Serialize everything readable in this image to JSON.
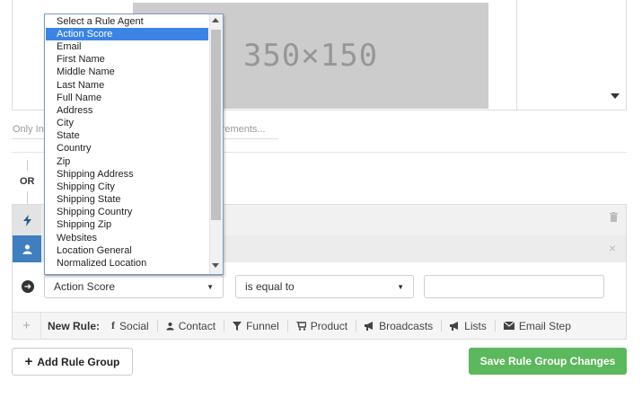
{
  "preview": {
    "placeholder_text": "350×150"
  },
  "helper": {
    "left_text": "Only Inc",
    "right_text": "quirements..."
  },
  "connector": {
    "or_label": "OR"
  },
  "rule_row": {
    "agent_select": {
      "value": "Action Score"
    },
    "operator_select": {
      "value": "is equal to"
    },
    "value_input": {
      "value": ""
    }
  },
  "dropdown": {
    "options": [
      "Select a Rule Agent",
      "Action Score",
      "Email",
      "First Name",
      "Middle Name",
      "Last Name",
      "Full Name",
      "Address",
      "City",
      "State",
      "Country",
      "Zip",
      "Shipping Address",
      "Shipping City",
      "Shipping State",
      "Shipping Country",
      "Shipping Zip",
      "Websites",
      "Location General",
      "Normalized Location"
    ],
    "selected": "Action Score"
  },
  "new_rule": {
    "label": "New Rule:",
    "items": [
      {
        "label": "Social",
        "icon": "facebook-icon"
      },
      {
        "label": "Contact",
        "icon": "user-icon"
      },
      {
        "label": "Funnel",
        "icon": "filter-icon"
      },
      {
        "label": "Product",
        "icon": "cart-icon"
      },
      {
        "label": "Broadcasts",
        "icon": "megaphone-icon"
      },
      {
        "label": "Lists",
        "icon": "megaphone-icon"
      },
      {
        "label": "Email Step",
        "icon": "envelope-icon"
      }
    ]
  },
  "buttons": {
    "add_rule_group": "Add Rule Group",
    "save_changes": "Save Rule Group Changes"
  },
  "colors": {
    "accent_blue": "#3f7fbf",
    "selected_option": "#3b84e6",
    "save_green": "#5cb85c"
  }
}
